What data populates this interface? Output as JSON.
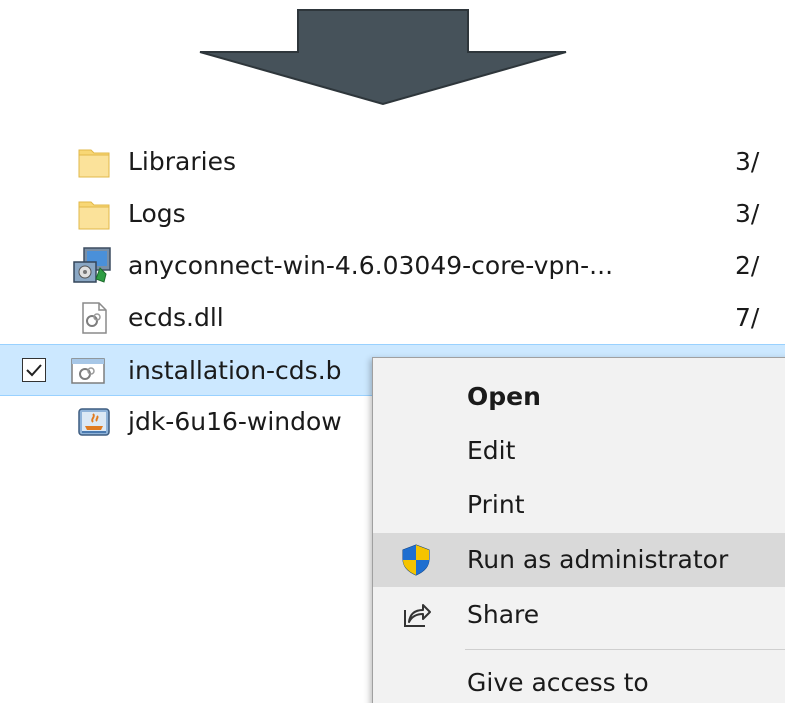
{
  "files": [
    {
      "name": "Libraries",
      "date": "3/",
      "icon": "folder-icon"
    },
    {
      "name": "Logs",
      "date": "3/",
      "icon": "folder-icon"
    },
    {
      "name": "anyconnect-win-4.6.03049-core-vpn-...",
      "date": "2/",
      "icon": "installer-icon"
    },
    {
      "name": "ecds.dll",
      "date": "7/",
      "icon": "dll-file-icon"
    },
    {
      "name": "installation-cds.b",
      "date": "",
      "icon": "batch-file-icon",
      "selected": true
    },
    {
      "name": "jdk-6u16-window",
      "date": "",
      "icon": "java-installer-icon"
    }
  ],
  "context_menu": {
    "open": "Open",
    "edit": "Edit",
    "print": "Print",
    "run_as_admin": "Run as administrator",
    "share": "Share",
    "give_access": "Give access to"
  },
  "colors": {
    "arrow": "#46525a",
    "selection": "#cce8ff",
    "menu_bg": "#f2f2f2",
    "menu_hover": "#d9d9d9",
    "folder": "#f8d775"
  }
}
